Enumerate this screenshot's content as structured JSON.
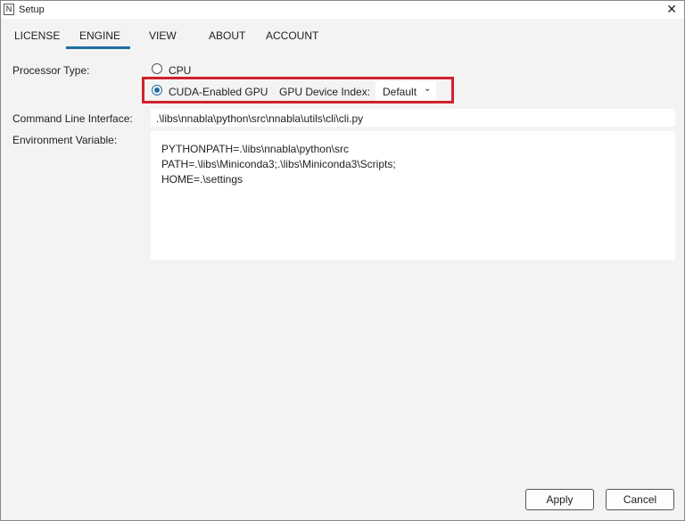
{
  "window": {
    "title": "Setup",
    "logo": "N",
    "close_icon": "close-icon"
  },
  "tabs": [
    {
      "label": "LICENSE"
    },
    {
      "label": "ENGINE",
      "active": true
    },
    {
      "label": "VIEW"
    },
    {
      "label": "ABOUT"
    },
    {
      "label": "ACCOUNT"
    }
  ],
  "engine": {
    "processor_type_label": "Processor Type:",
    "cpu_label": "CPU",
    "gpu_label": "CUDA-Enabled GPU",
    "selected": "CUDA-Enabled GPU",
    "gpu_index_label": "GPU Device Index:",
    "gpu_index_value": "Default",
    "cli_label": "Command Line Interface:",
    "cli_value": ".\\libs\\nnabla\\python\\src\\nnabla\\utils\\cli\\cli.py",
    "env_label": "Environment Variable:",
    "env_lines": [
      "PYTHONPATH=.\\libs\\nnabla\\python\\src",
      "PATH=.\\libs\\Miniconda3;.\\libs\\Miniconda3\\Scripts;",
      "HOME=.\\settings"
    ]
  },
  "buttons": {
    "apply": "Apply",
    "cancel": "Cancel"
  },
  "colors": {
    "accent": "#1e6ea0",
    "highlight": "#d0212e"
  }
}
